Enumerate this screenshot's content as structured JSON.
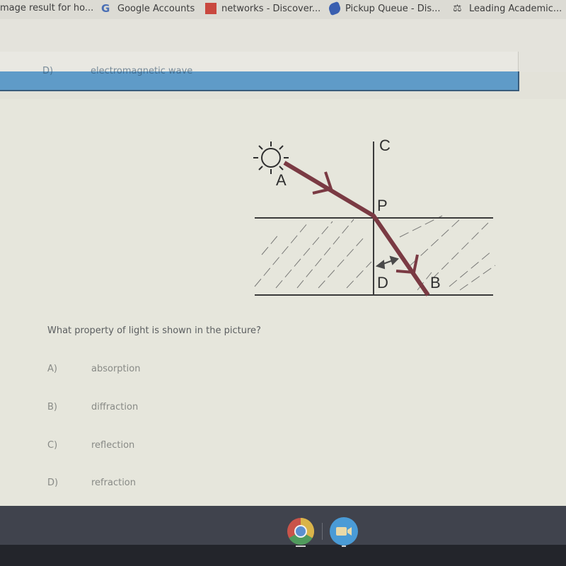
{
  "bookmarks": [
    {
      "label": "mage result for ho...",
      "icon": "image-icon"
    },
    {
      "label": "Google Accounts",
      "icon": "google-icon"
    },
    {
      "label": "networks - Discover...",
      "icon": "discover-icon"
    },
    {
      "label": "Pickup Queue - Dis...",
      "icon": "pickup-queue-icon"
    },
    {
      "label": "Leading Academic...",
      "icon": "academic-icon"
    }
  ],
  "previous_option": {
    "letter": "D)",
    "text": "electromagnetic wave"
  },
  "diagram": {
    "labels": {
      "A": "A",
      "B": "B",
      "C": "C",
      "D": "D",
      "P": "P"
    },
    "ray_color": "#7a3a43",
    "line_color": "#3a3a3a"
  },
  "question": "What property of light is shown in the picture?",
  "options": [
    {
      "letter": "A)",
      "text": "absorption"
    },
    {
      "letter": "B)",
      "text": "diffraction"
    },
    {
      "letter": "C)",
      "text": "reflection"
    },
    {
      "letter": "D)",
      "text": "refraction"
    }
  ],
  "shelf": {
    "apps": [
      {
        "name": "Chrome",
        "icon": "chrome-icon"
      },
      {
        "name": "Zoom",
        "icon": "zoom-icon"
      }
    ]
  }
}
